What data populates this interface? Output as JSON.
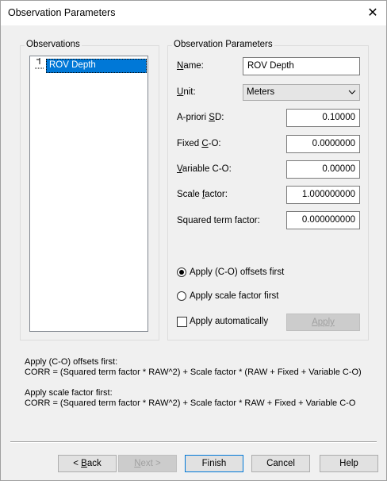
{
  "window": {
    "title": "Observation Parameters",
    "close_glyph": "✕"
  },
  "observations": {
    "group_label": "Observations",
    "items": [
      {
        "label": "ROV Depth",
        "selected": true
      }
    ]
  },
  "params": {
    "group_label": "Observation Parameters",
    "name_label": "Name:",
    "name_value": "ROV Depth",
    "unit_label": "Unit:",
    "unit_value": "Meters",
    "apriori_label": "A-priori SD:",
    "apriori_value": "0.10000",
    "fixed_label": "Fixed C-O:",
    "fixed_value": "0.0000000",
    "variable_label": "Variable C-O:",
    "variable_value": "0.00000",
    "scale_label": "Scale factor:",
    "scale_value": "1.000000000",
    "squared_label": "Squared term factor:",
    "squared_value": "0.000000000",
    "radio_offsets_label": "Apply (C-O) offsets first",
    "radio_scale_label": "Apply scale factor first",
    "selected_mode": "offsets",
    "apply_auto_label": "Apply automatically",
    "apply_auto_checked": false,
    "apply_button": "Apply"
  },
  "info": {
    "offsets_title": "Apply (C-O) offsets first:",
    "offsets_formula": "CORR = (Squared term factor * RAW^2) + Scale factor * (RAW + Fixed + Variable C-O)",
    "scale_title": "Apply scale factor first:",
    "scale_formula": "CORR = (Squared term factor * RAW^2) + Scale factor * RAW + Fixed + Variable C-O"
  },
  "buttons": {
    "back": "< Back",
    "next": "Next >",
    "finish": "Finish",
    "cancel": "Cancel",
    "help": "Help"
  },
  "colors": {
    "selection": "#0078d7",
    "dialog_bg": "#f0f0f0"
  }
}
